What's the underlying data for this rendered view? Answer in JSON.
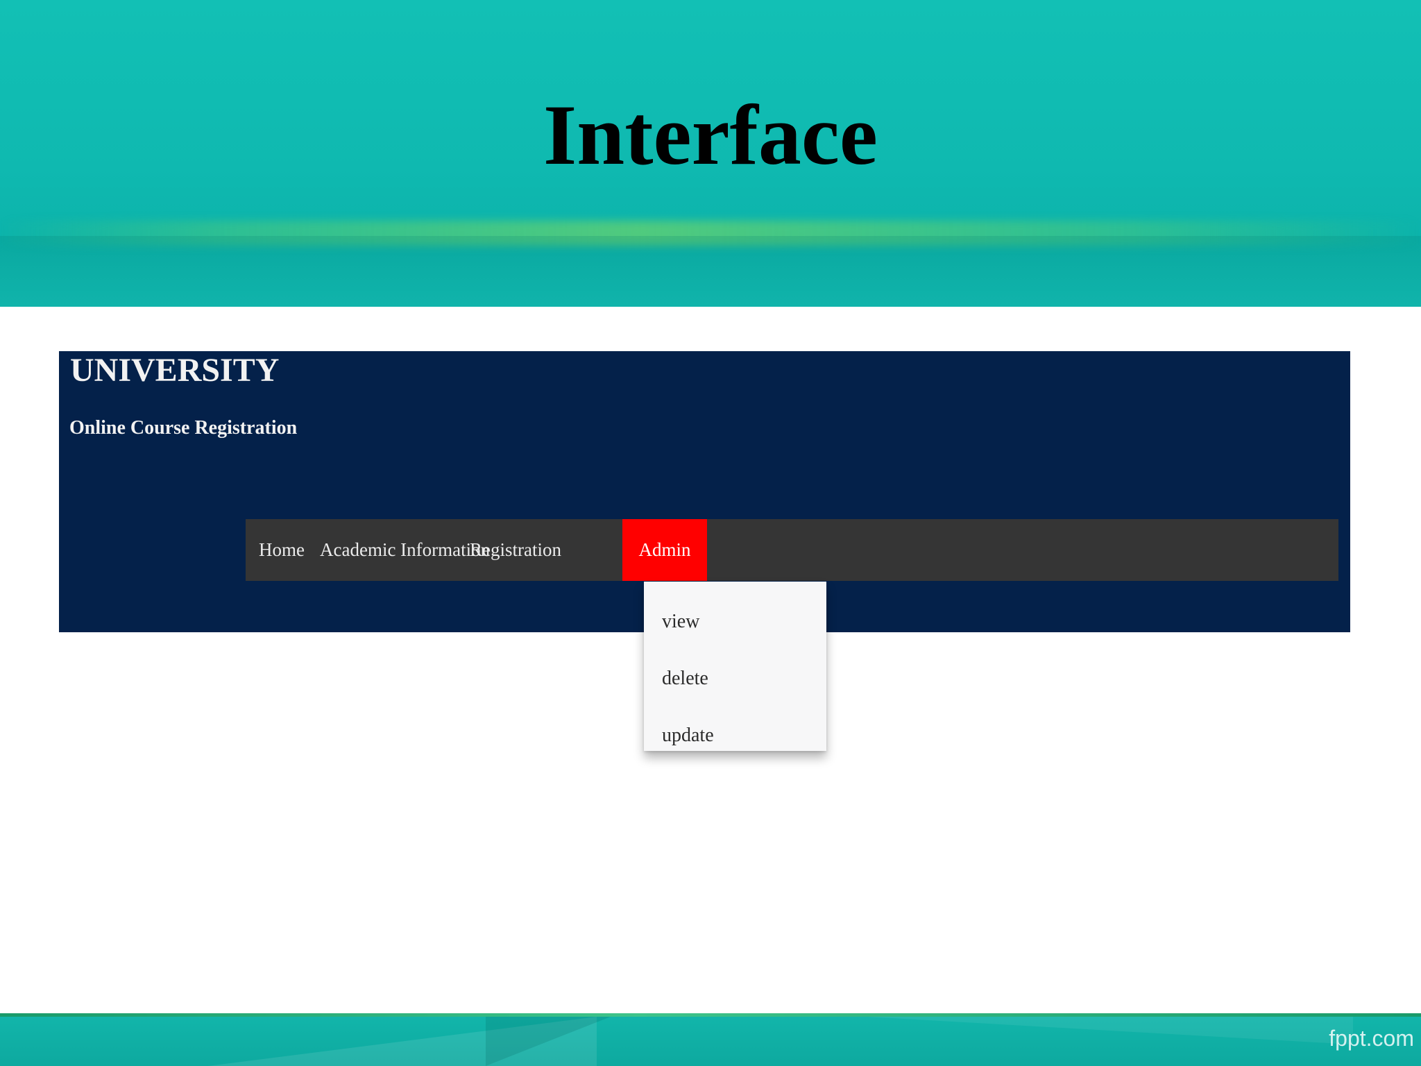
{
  "slide": {
    "title": "Interface",
    "footer_brand": "fppt.com"
  },
  "site": {
    "name": "UNIVERSITY",
    "subtitle": "Online Course Registration"
  },
  "nav": {
    "items": [
      {
        "label": "Home"
      },
      {
        "label": "Academic Information"
      },
      {
        "label": "Registration"
      },
      {
        "label": "Admin",
        "active": true
      }
    ],
    "active_color": "#ff0000",
    "bar_color": "#353535"
  },
  "admin_menu": {
    "items": [
      {
        "label": "view"
      },
      {
        "label": "delete"
      },
      {
        "label": "update"
      }
    ]
  },
  "colors": {
    "header_teal": "#0fb9b0",
    "site_header_navy": "#04214a"
  }
}
